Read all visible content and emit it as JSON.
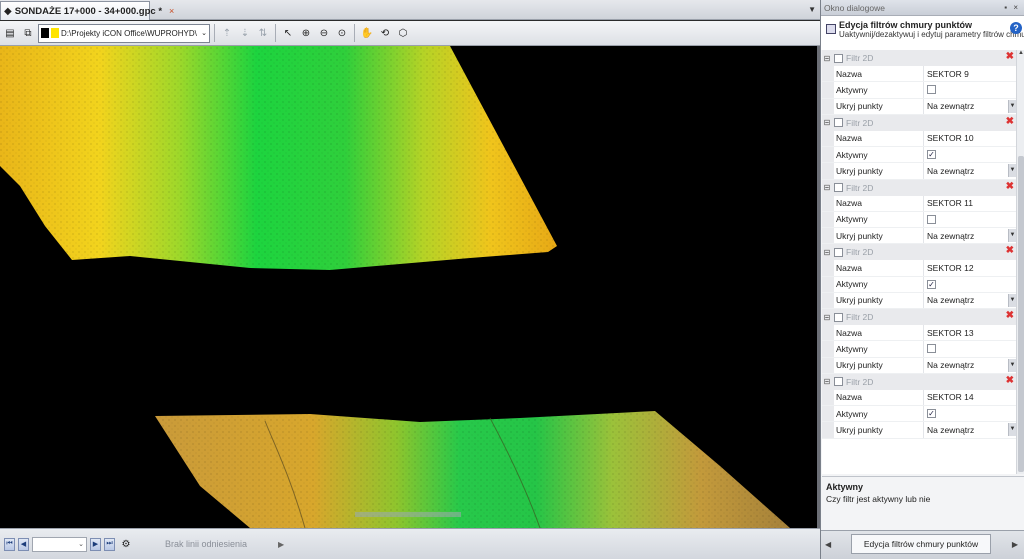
{
  "document": {
    "tab_title": "SONDAŻE 17+000 - 34+000.gpc *",
    "close_glyph": "×",
    "menu_glyph": "▼"
  },
  "toolbar": {
    "path": "D:\\Projekty iCON Office\\WUPROHYD\\Tor wo",
    "path_dropdown": "⌄",
    "color_swatches": [
      "#000000",
      "#ffe400"
    ]
  },
  "viewport": {
    "background": "#000000",
    "surface_colors": [
      "#e8b318",
      "#f0d020",
      "#9ad22a",
      "#2fd23f",
      "#1fcf3a",
      "#c39a3a"
    ]
  },
  "status": {
    "reference_line": "Brak linii odniesienia",
    "combo_value": ""
  },
  "panel": {
    "header": "Okno dialogowe",
    "pin_glyphs": "▪ ×",
    "title": "Edycja filtrów chmury punktów",
    "subtitle": "Uaktywnij/dezaktywuj i edytuj parametry filtrów chmury",
    "help_glyph": "?",
    "filters": [
      {
        "group_label": "Filtr 2D",
        "name_label": "Nazwa",
        "name_value": "SEKTOR 9",
        "active_label": "Aktywny",
        "active": false,
        "hide_label": "Ukryj punkty",
        "hide_value": "Na zewnątrz"
      },
      {
        "group_label": "Filtr 2D",
        "name_label": "Nazwa",
        "name_value": "SEKTOR 10",
        "active_label": "Aktywny",
        "active": true,
        "hide_label": "Ukryj punkty",
        "hide_value": "Na zewnątrz"
      },
      {
        "group_label": "Filtr 2D",
        "name_label": "Nazwa",
        "name_value": "SEKTOR 11",
        "active_label": "Aktywny",
        "active": false,
        "hide_label": "Ukryj punkty",
        "hide_value": "Na zewnątrz"
      },
      {
        "group_label": "Filtr 2D",
        "name_label": "Nazwa",
        "name_value": "SEKTOR 12",
        "active_label": "Aktywny",
        "active": true,
        "hide_label": "Ukryj punkty",
        "hide_value": "Na zewnątrz"
      },
      {
        "group_label": "Filtr 2D",
        "name_label": "Nazwa",
        "name_value": "SEKTOR 13",
        "active_label": "Aktywny",
        "active": false,
        "hide_label": "Ukryj punkty",
        "hide_value": "Na zewnątrz"
      },
      {
        "group_label": "Filtr 2D",
        "name_label": "Nazwa",
        "name_value": "SEKTOR 14",
        "active_label": "Aktywny",
        "active": true,
        "hide_label": "Ukryj punkty",
        "hide_value": "Na zewnątrz"
      }
    ],
    "description_title": "Aktywny",
    "description_text": "Czy filtr jest aktywny lub nie",
    "footer_tab": "Edycja filtrów chmury punktów"
  }
}
